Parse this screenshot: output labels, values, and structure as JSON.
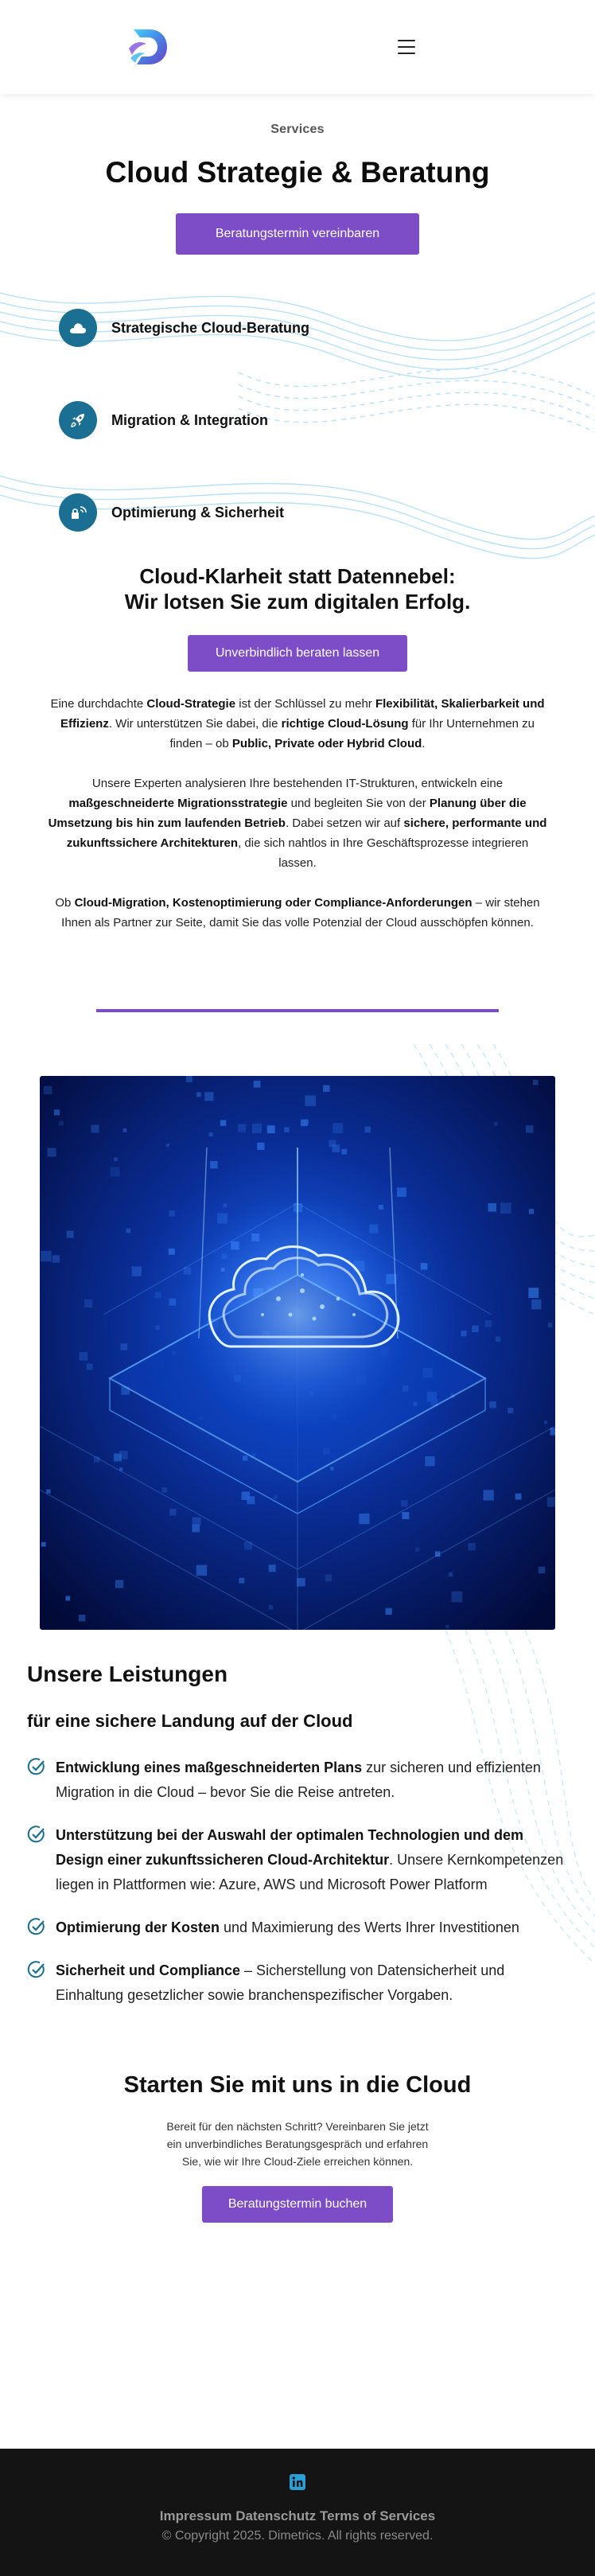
{
  "header": {
    "logo_alt": "Dimetrics",
    "menu_icon": "hamburger-menu-icon"
  },
  "hero": {
    "eyebrow": "Services",
    "title": "Cloud Strategie & Beratung",
    "cta_label": "Beratungstermin vereinbaren"
  },
  "services": [
    {
      "label": "Strategische Cloud-Beratung",
      "icon": "cloud-icon"
    },
    {
      "label": "Migration & Integration",
      "icon": "rocket-icon"
    },
    {
      "label": "Optimierung & Sicherheit",
      "icon": "lock-wifi-icon"
    }
  ],
  "intro": {
    "title_line1": "Cloud-Klarheit statt Datennebel:",
    "title_line2": "Wir lotsen Sie zum digitalen Erfolg.",
    "cta_label": "Unverbindlich beraten lassen",
    "p1": [
      {
        "t": "Eine durchdachte ",
        "b": false
      },
      {
        "t": "Cloud-Strategie",
        "b": true
      },
      {
        "t": " ist der Schlüssel zu mehr ",
        "b": false
      },
      {
        "t": "Flexibilität, Skalierbarkeit und Effizienz",
        "b": true
      },
      {
        "t": ". Wir unterstützen Sie dabei, die ",
        "b": false
      },
      {
        "t": "richtige Cloud-Lösung",
        "b": true
      },
      {
        "t": " für Ihr Unternehmen zu finden – ob ",
        "b": false
      },
      {
        "t": "Public, Private oder Hybrid Cloud",
        "b": true
      },
      {
        "t": ".",
        "b": false
      }
    ],
    "p2": [
      {
        "t": "Unsere Experten analysieren Ihre bestehenden IT-Strukturen, entwickeln eine ",
        "b": false
      },
      {
        "t": "maßgeschneiderte Migrationsstrategie",
        "b": true
      },
      {
        "t": " und begleiten Sie von der ",
        "b": false
      },
      {
        "t": "Planung über die Umsetzung bis hin zum laufenden Betrieb",
        "b": true
      },
      {
        "t": ". Dabei setzen wir auf ",
        "b": false
      },
      {
        "t": "sichere, performante und zukunftssichere Architekturen",
        "b": true
      },
      {
        "t": ", die sich nahtlos in Ihre Geschäftsprozesse integrieren lassen.",
        "b": false
      }
    ],
    "p3": [
      {
        "t": "Ob ",
        "b": false
      },
      {
        "t": "Cloud-Migration, Kostenoptimierung oder Compliance-Anforderungen",
        "b": true
      },
      {
        "t": " – wir stehen Ihnen als Partner zur Seite, damit Sie das volle Potenzial der Cloud ausschöpfen können.",
        "b": false
      }
    ]
  },
  "image": {
    "alt": "cloud-chip-illustration"
  },
  "leistungen": {
    "title": "Unsere Leistungen",
    "subtitle": "für eine sichere Landung auf der Cloud",
    "items": [
      [
        {
          "t": "Entwicklung eines maßgeschneiderten Plans",
          "b": true
        },
        {
          "t": " zur sicheren und effizienten Migration in die Cloud – bevor Sie die Reise antreten.",
          "b": false
        }
      ],
      [
        {
          "t": "Unterstützung bei der Auswahl der optimalen Technologien und dem Design einer zukunftssicheren Cloud-Architektur",
          "b": true
        },
        {
          "t": ". Unsere Kernkompetenzen liegen in Plattformen wie: Azure, AWS und Microsoft Power Platform",
          "b": false
        }
      ],
      [
        {
          "t": "Optimierung der Kosten",
          "b": true
        },
        {
          "t": " und Maximierung des Werts Ihrer Investitionen",
          "b": false
        }
      ],
      [
        {
          "t": "Sicherheit und Compliance",
          "b": true
        },
        {
          "t": " – Sicherstellung von Datensicherheit und Einhaltung gesetzlicher sowie branchenspezifischer Vorgaben.",
          "b": false
        }
      ]
    ]
  },
  "cta": {
    "title": "Starten Sie mit uns in die Cloud",
    "text": "Bereit für den nächsten Schritt? Vereinbaren Sie jetzt ein unverbindliches Beratungsgespräch und erfahren Sie, wie wir Ihre Cloud-Ziele erreichen können.",
    "button_label": "Beratungstermin buchen"
  },
  "footer": {
    "social_icon": "linkedin-icon",
    "links": [
      "Impressum",
      "Datenschutz",
      "Terms of Services"
    ],
    "copyright": "© Copyright 2025. Dimetrics. All rights reserved."
  },
  "colors": {
    "accent": "#7d4dc7",
    "icon_bg": "#1a6f93",
    "check": "#1a6f93",
    "footer_bg": "#141414"
  }
}
